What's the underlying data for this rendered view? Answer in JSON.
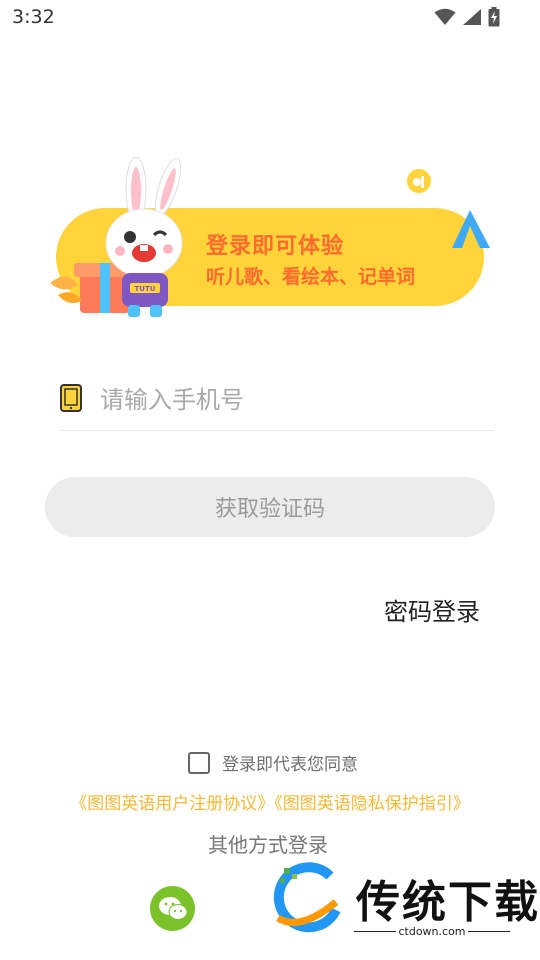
{
  "status_bar": {
    "time": "3:32",
    "icons": [
      "wifi-icon",
      "cell-signal-icon",
      "battery-charging-icon"
    ]
  },
  "banner": {
    "line1": "登录即可体验",
    "line2": "听儿歌、看绘本、记单词",
    "mascot_shirt": "TUTU",
    "colors": {
      "background": "#ffd43b",
      "text": "#ff6a2d"
    }
  },
  "phone": {
    "placeholder": "请输入手机号",
    "value": ""
  },
  "buttons": {
    "get_code": "获取验证码",
    "password_login": "密码登录"
  },
  "agreement": {
    "text": "登录即代表您同意",
    "checked": false,
    "user_agreement": "《图图英语用户注册协议》",
    "privacy_policy": "《图图英语隐私保护指引》"
  },
  "other_login": {
    "label": "其他方式登录",
    "methods": [
      "wechat-icon"
    ]
  },
  "watermark": {
    "title": "传统下载",
    "url": "ctdown.com"
  },
  "colors": {
    "accent": "#ffd43b",
    "link": "#f5b935",
    "wechat": "#7cc32b"
  }
}
